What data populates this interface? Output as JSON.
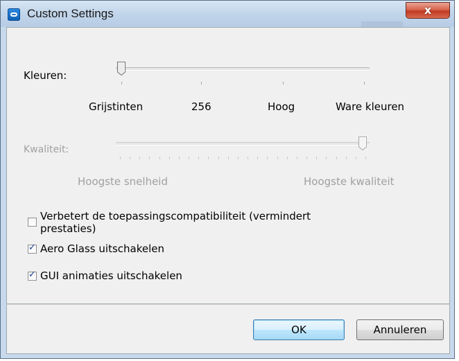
{
  "window": {
    "title": "Custom Settings",
    "close_label": "x"
  },
  "colors": {
    "label": "Kleuren:",
    "value_fraction": 0,
    "ticks": [
      "Grijstinten",
      "256",
      "Hoog",
      "Ware kleuren"
    ]
  },
  "quality": {
    "label": "Kwaliteit:",
    "enabled": false,
    "value_fraction": 1,
    "left_label": "Hoogste snelheid",
    "right_label": "Hoogste kwaliteit"
  },
  "options": [
    {
      "label_line1": "Verbetert de toepassingscompatibiliteit (vermindert",
      "label_line2": "prestaties)",
      "checked": false
    },
    {
      "label": "Aero Glass uitschakelen",
      "checked": true
    },
    {
      "label": "GUI animaties uitschakelen",
      "checked": true
    }
  ],
  "buttons": {
    "ok": "OK",
    "cancel": "Annuleren"
  }
}
